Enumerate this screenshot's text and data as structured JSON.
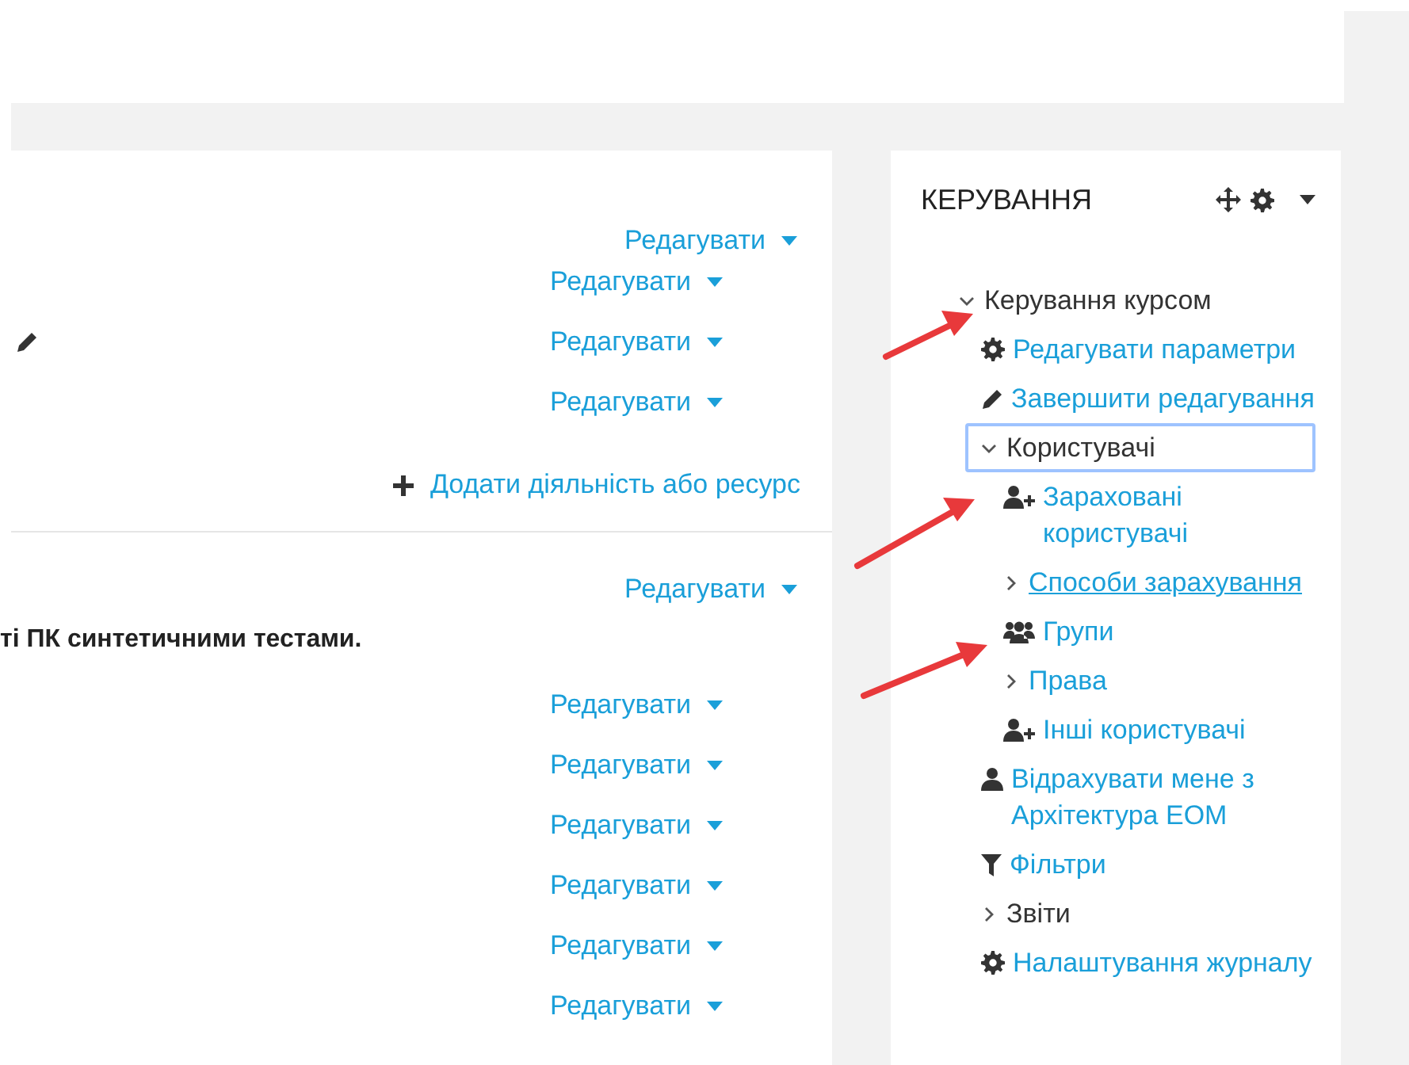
{
  "main": {
    "sections": [
      {
        "edit": "Редагувати",
        "activities": [
          {
            "edit": "Редагувати",
            "editing_icon": false
          },
          {
            "edit": "Редагувати",
            "editing_icon": true
          },
          {
            "edit": "Редагувати",
            "editing_icon": false
          }
        ],
        "add_activity": "Додати діяльність або ресурс"
      },
      {
        "edit": "Редагувати",
        "summary": "ті ПК синтетичними тестами.",
        "activities": [
          {
            "edit": "Редагувати",
            "editing_icon": false
          },
          {
            "edit": "Редагувати",
            "editing_icon": false
          },
          {
            "edit": "Редагувати",
            "editing_icon": false
          },
          {
            "edit": "Редагувати",
            "editing_icon": false
          },
          {
            "edit": "Редагувати",
            "editing_icon": false
          },
          {
            "edit": "Редагувати",
            "editing_icon": false
          }
        ]
      }
    ]
  },
  "block": {
    "title": "КЕРУВАННЯ",
    "tree": [
      {
        "kind": "branch",
        "label": "Керування курсом",
        "expanded": true,
        "linked": false,
        "focused": false,
        "underlined": false,
        "children": [
          {
            "kind": "gear",
            "label": "Редагувати параметри"
          },
          {
            "kind": "pencil",
            "label": "Завершити редагування"
          },
          {
            "kind": "branch",
            "label": "Користувачі",
            "expanded": true,
            "linked": false,
            "focused": true,
            "underlined": false,
            "children": [
              {
                "kind": "user_plus",
                "label": "Зараховані користувачі"
              },
              {
                "kind": "branch",
                "label": "Способи зарахування",
                "expanded": false,
                "linked": true,
                "focused": false,
                "underlined": true
              },
              {
                "kind": "users",
                "label": "Групи"
              },
              {
                "kind": "branch",
                "label": "Права",
                "expanded": false,
                "linked": true,
                "focused": false,
                "underlined": false
              },
              {
                "kind": "user_plus",
                "label": "Інші користувачі"
              }
            ]
          },
          {
            "kind": "user",
            "label": "Відрахувати мене з Архітектура ЕОМ"
          },
          {
            "kind": "filter",
            "label": "Фільтри"
          },
          {
            "kind": "branch",
            "label": "Звіти",
            "expanded": false,
            "linked": false,
            "focused": false,
            "underlined": false
          },
          {
            "kind": "gear",
            "label": "Налаштування журналу"
          }
        ]
      }
    ]
  }
}
